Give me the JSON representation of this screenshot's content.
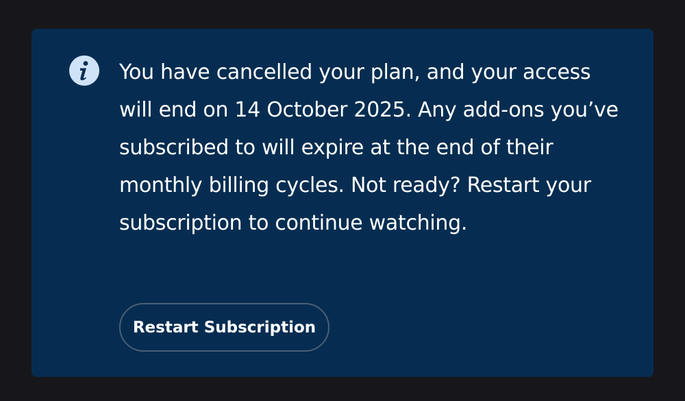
{
  "notice": {
    "icon": "info-icon",
    "message": "You have cancelled your plan, and your access will end on 14 October 2025. Any add-ons you’ve subscribed to will expire at the end of their monthly billing cycles. Not ready? Restart your subscription to continue watching.",
    "button_label": "Restart Subscription"
  },
  "colors": {
    "page_background": "#17171b",
    "banner_background": "#062d51",
    "icon_fill": "#cfe3f7",
    "text": "#ffffff",
    "button_border": "#4a5f78"
  }
}
